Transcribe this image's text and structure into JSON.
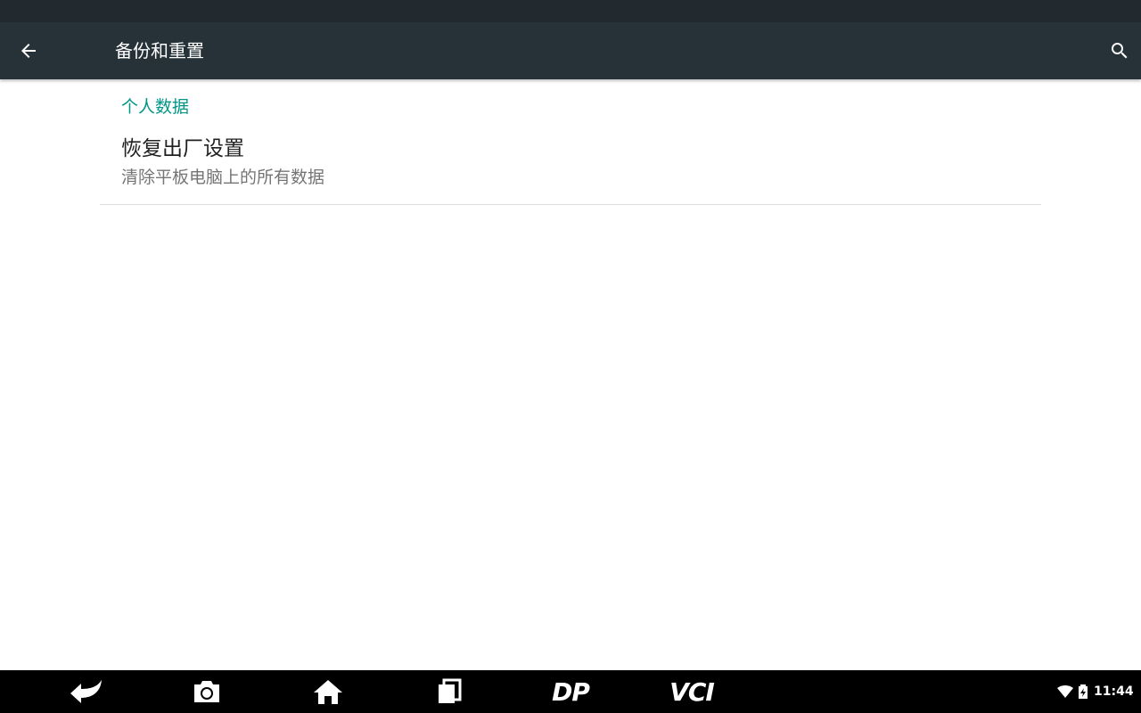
{
  "appbar": {
    "title": "备份和重置",
    "back_icon": "arrow-back-icon",
    "search_icon": "search-icon"
  },
  "section": {
    "header": "个人数据"
  },
  "preferences": [
    {
      "title": "恢复出厂设置",
      "summary": "清除平板电脑上的所有数据"
    }
  ],
  "navbar": {
    "buttons": [
      {
        "name": "back",
        "icon": "back-arrow-icon"
      },
      {
        "name": "screenshot",
        "icon": "camera-icon"
      },
      {
        "name": "home",
        "icon": "home-icon"
      },
      {
        "name": "recents",
        "icon": "recent-apps-icon"
      },
      {
        "name": "dp",
        "label": "DP"
      },
      {
        "name": "vci",
        "label": "VCI"
      }
    ],
    "status": {
      "time": "11:44",
      "wifi_icon": "wifi-icon",
      "battery_icon": "battery-charging-icon"
    }
  },
  "colors": {
    "appbar": "#263238",
    "accent": "#009688",
    "statusbar": "#222a30"
  }
}
